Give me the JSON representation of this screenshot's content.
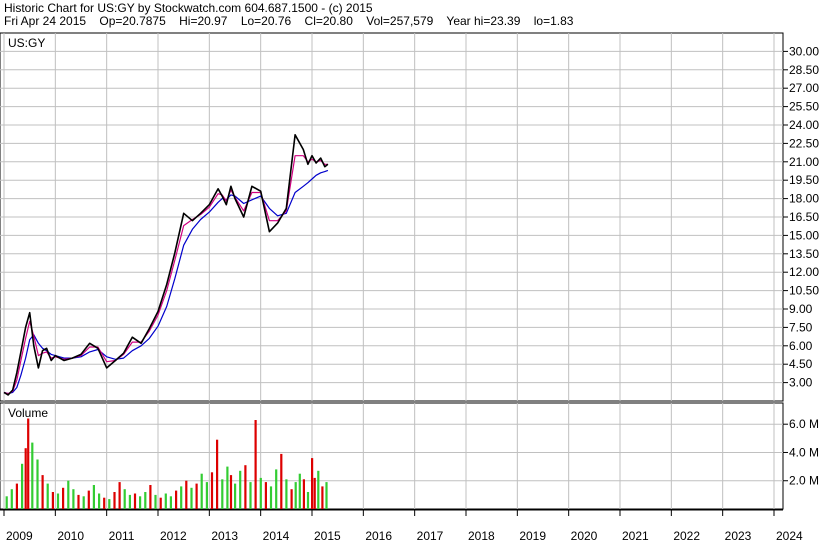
{
  "header": {
    "line1": "Historic Chart for US:GY by Stockwatch.com 604.687.1500 - (c) 2015",
    "line2": "Fri Apr 24 2015    Op=20.7875    Hi=20.97    Lo=20.76    Cl=20.80    Vol=257,579    Year hi=23.39    lo=1.83"
  },
  "colors": {
    "grid": "#c0c0c0",
    "price": "#000000",
    "ma_short": "#d00080",
    "ma_long": "#0000cc",
    "vol_up": "#33cc33",
    "vol_down": "#dd0000"
  },
  "chart_data": [
    {
      "type": "line",
      "label": "US:GY",
      "y_ticks": [
        "30.00",
        "28.50",
        "27.00",
        "25.50",
        "24.00",
        "22.50",
        "21.00",
        "19.50",
        "18.00",
        "16.50",
        "15.00",
        "13.50",
        "12.00",
        "10.50",
        "9.00",
        "7.50",
        "6.00",
        "4.50",
        "3.00"
      ],
      "ylim": [
        1.5,
        31.5
      ],
      "x_ticks": [
        "2009",
        "2010",
        "2011",
        "2012",
        "2013",
        "2014",
        "2015",
        "2016",
        "2017",
        "2018",
        "2019",
        "2020",
        "2021",
        "2022",
        "2023",
        "2024"
      ],
      "xlim": [
        2009.0,
        2024.0
      ],
      "x": [
        2009.0,
        2009.08,
        2009.17,
        2009.25,
        2009.33,
        2009.42,
        2009.5,
        2009.58,
        2009.67,
        2009.75,
        2009.83,
        2009.92,
        2010.0,
        2010.17,
        2010.33,
        2010.5,
        2010.67,
        2010.83,
        2011.0,
        2011.17,
        2011.33,
        2011.5,
        2011.67,
        2011.83,
        2012.0,
        2012.17,
        2012.33,
        2012.5,
        2012.67,
        2012.83,
        2013.0,
        2013.17,
        2013.25,
        2013.33,
        2013.42,
        2013.5,
        2013.67,
        2013.83,
        2014.0,
        2014.17,
        2014.33,
        2014.5,
        2014.67,
        2014.83,
        2014.92,
        2015.0,
        2015.08,
        2015.17,
        2015.25,
        2015.31
      ],
      "series": [
        {
          "name": "",
          "values": [
            2.2,
            2.0,
            2.4,
            3.8,
            5.5,
            7.5,
            8.7,
            6.0,
            4.2,
            5.6,
            5.8,
            4.8,
            5.2,
            4.8,
            5.0,
            5.3,
            6.2,
            5.8,
            4.2,
            4.8,
            5.4,
            6.7,
            6.2,
            7.4,
            8.8,
            11.0,
            13.6,
            16.8,
            16.2,
            16.8,
            17.5,
            18.8,
            18.2,
            17.5,
            19.0,
            18.0,
            16.5,
            19.0,
            18.6,
            15.3,
            16.0,
            17.2,
            23.2,
            22.0,
            20.8,
            21.5,
            20.9,
            21.3,
            20.6,
            20.8
          ]
        },
        {
          "name": "",
          "values": [
            2.2,
            2.1,
            2.3,
            3.2,
            4.8,
            6.6,
            8.0,
            6.8,
            5.2,
            5.4,
            5.5,
            5.0,
            5.1,
            4.9,
            5.0,
            5.2,
            5.9,
            5.9,
            4.7,
            4.8,
            5.3,
            6.3,
            6.3,
            7.2,
            8.5,
            10.5,
            13.0,
            15.8,
            16.3,
            16.7,
            17.3,
            18.4,
            18.3,
            17.8,
            18.7,
            18.1,
            17.0,
            18.5,
            18.5,
            16.2,
            16.2,
            17.0,
            21.5,
            21.5,
            21.0,
            21.2,
            21.0,
            21.1,
            20.8,
            20.8
          ]
        },
        {
          "name": "",
          "values": [
            2.2,
            2.1,
            2.2,
            2.6,
            3.6,
            5.0,
            6.5,
            6.9,
            6.2,
            5.8,
            5.6,
            5.3,
            5.2,
            5.0,
            5.0,
            5.1,
            5.5,
            5.7,
            5.1,
            4.9,
            5.0,
            5.6,
            6.0,
            6.6,
            7.6,
            9.2,
            11.5,
            14.2,
            15.5,
            16.3,
            16.9,
            17.7,
            18.0,
            17.9,
            18.3,
            18.2,
            17.6,
            17.9,
            18.2,
            17.2,
            16.6,
            16.8,
            18.5,
            19.0,
            19.3,
            19.6,
            19.9,
            20.1,
            20.2,
            20.3
          ]
        }
      ]
    },
    {
      "type": "bar",
      "label": "Volume",
      "y_ticks": [
        "6.0 M",
        "4.0 M",
        "2.0 M"
      ],
      "ylim": [
        0,
        7.5
      ],
      "units": "M",
      "x": [
        2009.05,
        2009.15,
        2009.25,
        2009.35,
        2009.42,
        2009.47,
        2009.55,
        2009.65,
        2009.75,
        2009.85,
        2009.95,
        2010.05,
        2010.15,
        2010.25,
        2010.35,
        2010.45,
        2010.55,
        2010.65,
        2010.75,
        2010.85,
        2010.95,
        2011.05,
        2011.15,
        2011.25,
        2011.35,
        2011.45,
        2011.55,
        2011.65,
        2011.75,
        2011.85,
        2011.95,
        2012.05,
        2012.15,
        2012.25,
        2012.35,
        2012.45,
        2012.55,
        2012.65,
        2012.75,
        2012.85,
        2012.95,
        2013.05,
        2013.15,
        2013.25,
        2013.35,
        2013.42,
        2013.5,
        2013.6,
        2013.7,
        2013.8,
        2013.9,
        2014.0,
        2014.1,
        2014.2,
        2014.3,
        2014.4,
        2014.5,
        2014.6,
        2014.68,
        2014.76,
        2014.84,
        2014.92,
        2015.0,
        2015.05,
        2015.12,
        2015.2,
        2015.28
      ],
      "values": [
        0.9,
        1.4,
        1.8,
        3.2,
        4.3,
        6.4,
        4.7,
        3.5,
        2.4,
        1.8,
        1.2,
        1.1,
        1.5,
        2.0,
        1.4,
        1.0,
        0.9,
        1.3,
        1.7,
        1.1,
        0.8,
        0.7,
        1.2,
        1.9,
        1.4,
        1.0,
        1.1,
        0.9,
        1.2,
        1.7,
        1.0,
        0.8,
        1.1,
        0.9,
        1.3,
        1.6,
        2.0,
        1.5,
        1.8,
        2.5,
        1.9,
        2.6,
        4.9,
        2.1,
        3.0,
        2.4,
        1.8,
        2.7,
        3.1,
        1.9,
        6.3,
        2.2,
        1.9,
        1.6,
        2.8,
        3.9,
        2.1,
        1.4,
        1.9,
        2.5,
        2.1,
        1.2,
        3.6,
        2.2,
        2.7,
        1.6,
        1.9
      ],
      "up": [
        true,
        true,
        false,
        true,
        false,
        false,
        true,
        true,
        false,
        true,
        false,
        true,
        false,
        true,
        true,
        false,
        true,
        false,
        true,
        true,
        false,
        true,
        false,
        false,
        true,
        true,
        false,
        true,
        true,
        false,
        true,
        false,
        true,
        true,
        false,
        true,
        false,
        true,
        false,
        true,
        true,
        false,
        false,
        true,
        true,
        false,
        true,
        true,
        false,
        true,
        false,
        true,
        false,
        true,
        true,
        false,
        true,
        false,
        true,
        true,
        false,
        true,
        false,
        false,
        true,
        false,
        true
      ]
    }
  ]
}
